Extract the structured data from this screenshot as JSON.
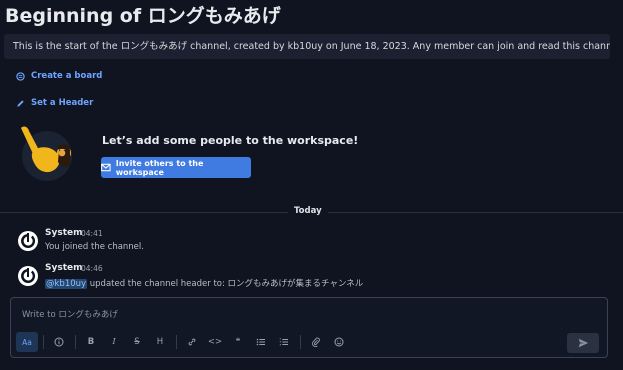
{
  "channel": {
    "title": "Beginning of ロングもみあげ",
    "intro_text": "This is the start of the ロングもみあげ channel, created by kb10uy on June 18, 2023. Any member can join and read this channel."
  },
  "actions": {
    "create_board": "Create a board",
    "set_header": "Set a Header"
  },
  "invite": {
    "heading": "Let’s add some people to the workspace!",
    "button_label": "Invite others to the workspace"
  },
  "date_separator": "Today",
  "posts": [
    {
      "author": "System",
      "time": "04:41",
      "message": "You joined the channel."
    },
    {
      "author": "System",
      "time": "04:46",
      "mention": "@kb10uy",
      "message": " updated the channel header to: ロングもみあげが集まるチャンネル"
    }
  ],
  "composer": {
    "placeholder": "Write to ロングもみあげ",
    "format_toggle": "Aa",
    "bold": "B",
    "italic": "I",
    "strike": "S",
    "heading": "H",
    "code": "<>",
    "quote": "❝"
  },
  "colors": {
    "background": "#0f1420",
    "accent": "#3f7be0",
    "link": "#6fa3ff"
  }
}
